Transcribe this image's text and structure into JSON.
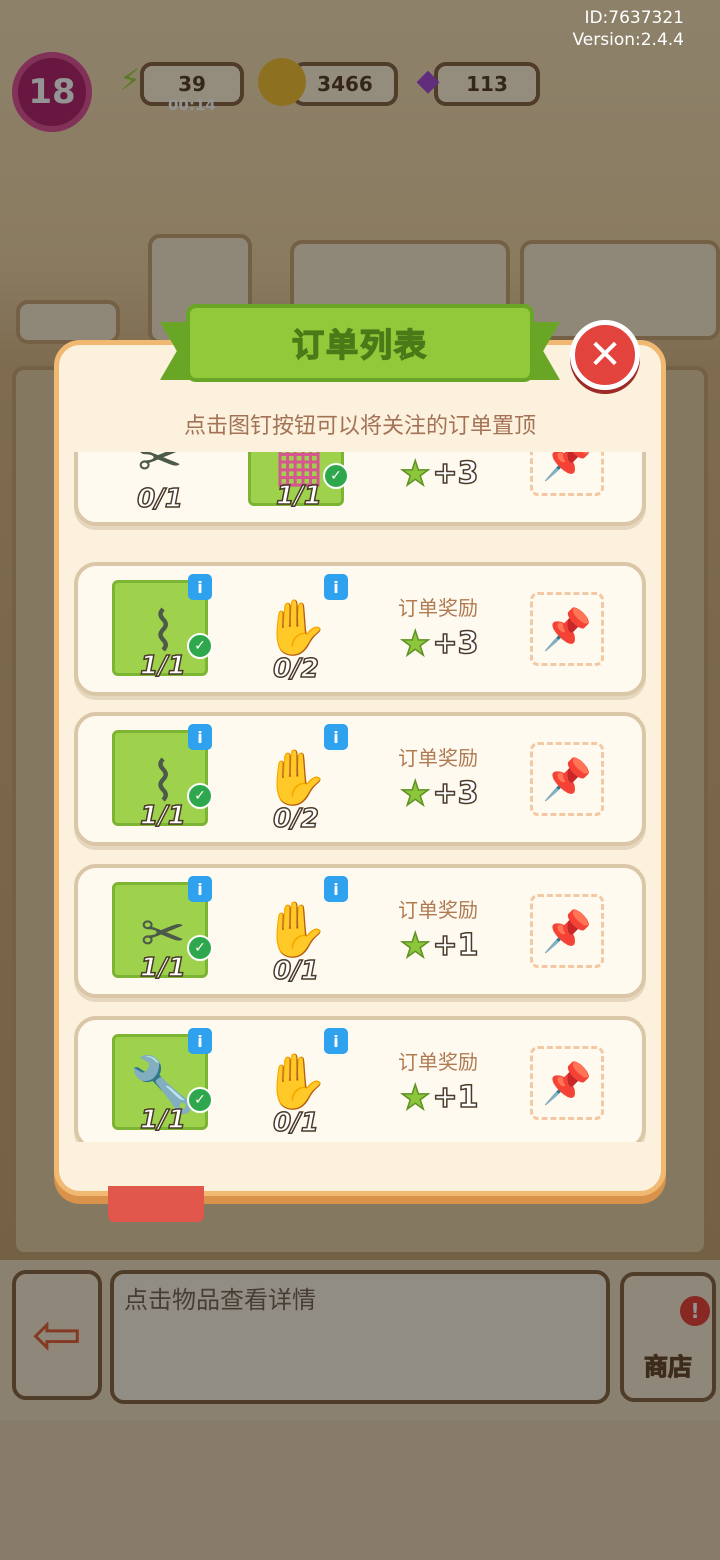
{
  "header": {
    "id_text": "ID:7637321",
    "version_text": "Version:2.4.4",
    "level": "18",
    "energy": "39",
    "energy_timer": "00:14",
    "coins": "3466",
    "gems": "113"
  },
  "background_orders": {
    "stars_left": "3",
    "stars_right": "3",
    "player_stars": "1",
    "counts": [
      "1/1",
      "0/2"
    ]
  },
  "bottom_bar": {
    "hint": "点击物品查看详情",
    "shop_label": "商店",
    "shop_badge": "!"
  },
  "modal": {
    "title": "订单列表",
    "subtitle": "点击图钉按钮可以将关注的订单置顶",
    "reward_label": "订单奖励",
    "orders": [
      {
        "item1": {
          "icon": "pliers-icon",
          "count": "0/1",
          "done": false
        },
        "item2": {
          "icon": "bricks-icon",
          "count": "1/1",
          "done": true
        },
        "reward": "+3"
      },
      {
        "item1": {
          "icon": "hacksaw-icon",
          "count": "1/1",
          "done": true
        },
        "item2": {
          "icon": "gloves-icon",
          "count": "0/2",
          "done": false
        },
        "reward": "+3"
      },
      {
        "item1": {
          "icon": "hacksaw-icon",
          "count": "1/1",
          "done": true
        },
        "item2": {
          "icon": "gloves-icon",
          "count": "0/2",
          "done": false
        },
        "reward": "+3"
      },
      {
        "item1": {
          "icon": "pliers-icon",
          "count": "1/1",
          "done": true
        },
        "item2": {
          "icon": "gloves-icon",
          "count": "0/1",
          "done": false
        },
        "reward": "+1"
      },
      {
        "item1": {
          "icon": "wrench-icon",
          "count": "1/1",
          "done": true
        },
        "item2": {
          "icon": "gloves-icon",
          "count": "0/1",
          "done": false
        },
        "reward": "+1"
      }
    ]
  },
  "colors": {
    "accent_green": "#92c93a",
    "close_red": "#e2433d",
    "info_blue": "#2ea2ef",
    "modal_border": "#f1b872"
  }
}
